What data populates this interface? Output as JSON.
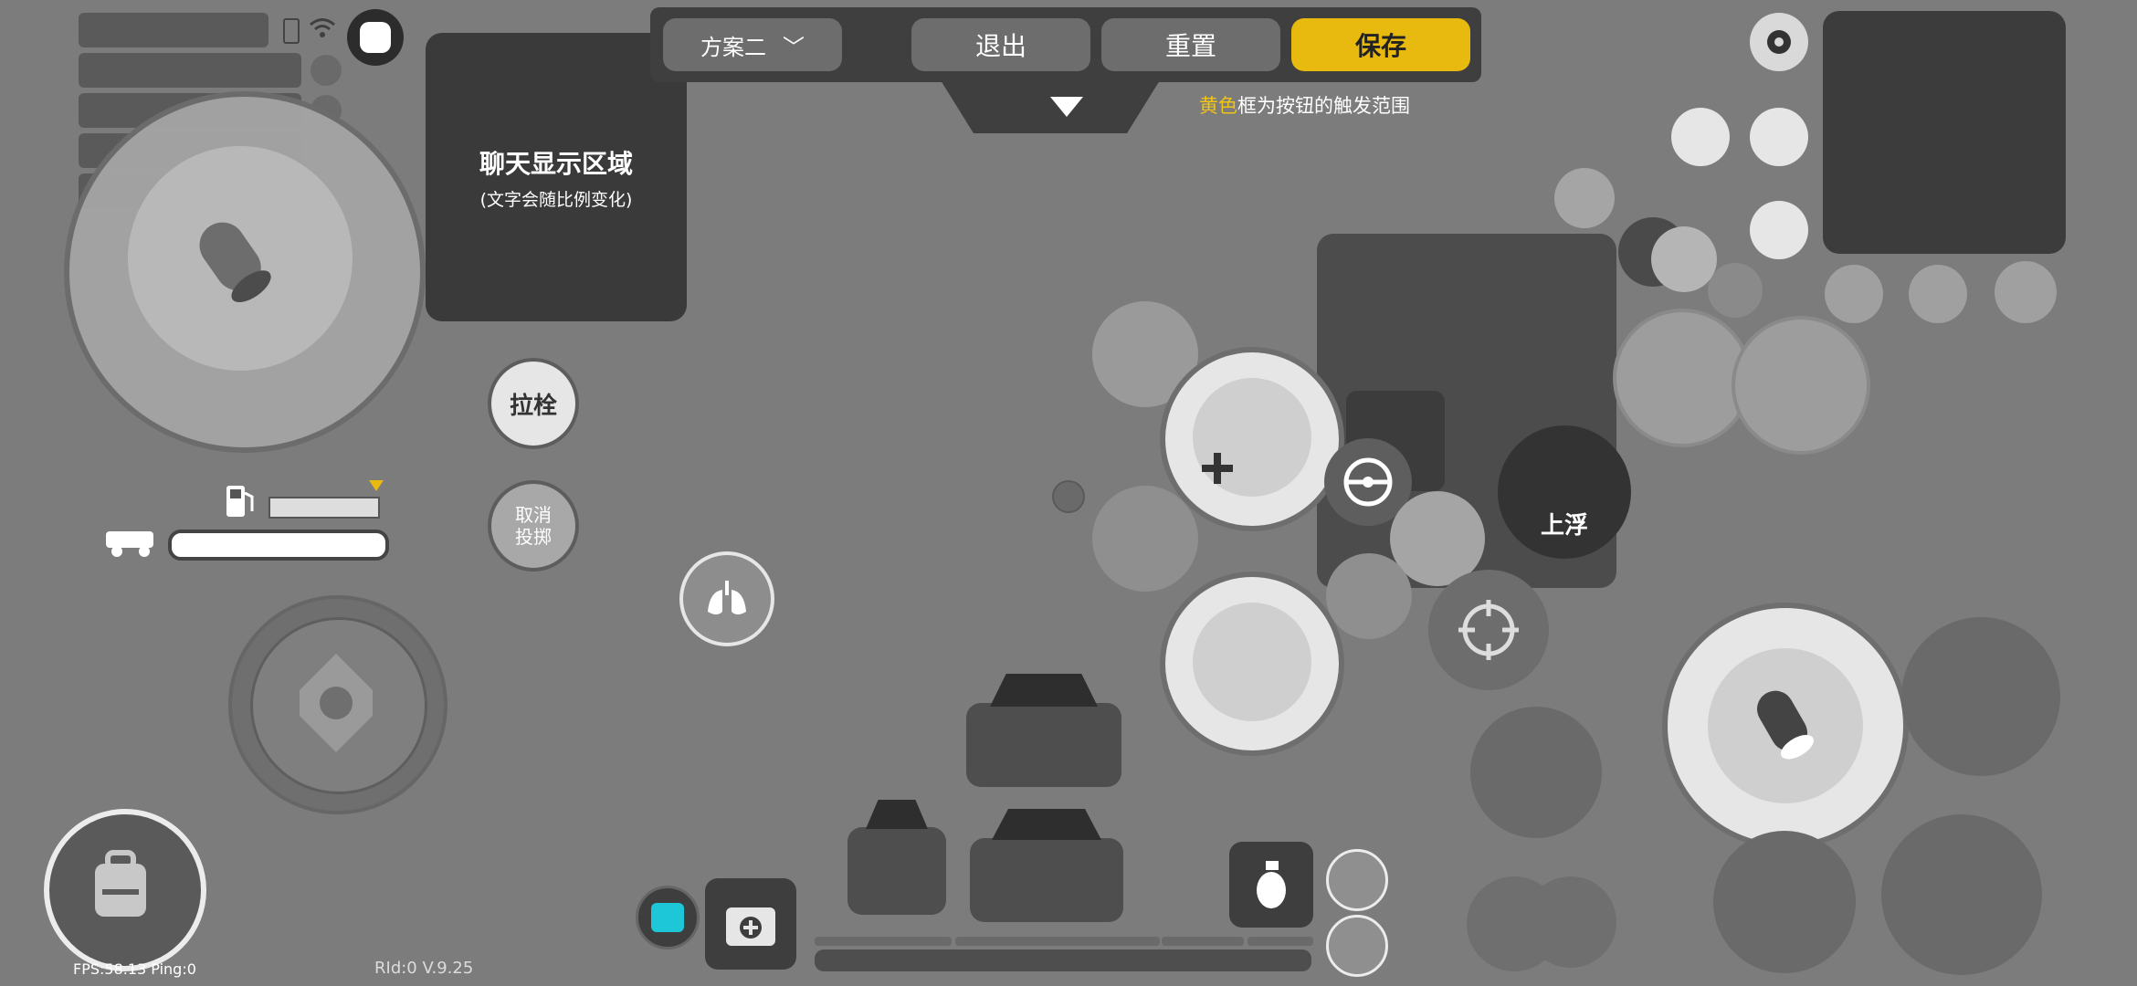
{
  "toolbar": {
    "scheme_label": "方案二",
    "exit_label": "退出",
    "reset_label": "重置",
    "save_label": "保存"
  },
  "hint": {
    "highlight": "黄色",
    "rest": "框为按钮的触发范围"
  },
  "chat": {
    "title": "聊天显示区域",
    "subtitle": "(文字会随比例变化)"
  },
  "buttons": {
    "bolt_label": "拉栓",
    "cancel_throw_label": "取消投掷",
    "float_up_label": "上浮"
  },
  "footer": {
    "fps": "FPS:58.13 Ping:0",
    "version": "RId:0 V.9.25"
  },
  "colors": {
    "accent": "#e8b90f",
    "background": "#7c7c7c",
    "panel": "#3f3f3f"
  },
  "icons": [
    "battery-icon",
    "wifi-icon",
    "emoji-face-icon",
    "settings-gear-icon",
    "exit-door-icon",
    "speaker-icon",
    "microphone-icon",
    "eye-icon",
    "chat-bubble-icon",
    "lungs-icon",
    "crosshair-icon",
    "steering-wheel-icon",
    "fuel-icon",
    "vehicle-icon",
    "backpack-icon",
    "medkit-icon",
    "grenade-icon",
    "bullet-icon",
    "shirt-icon"
  ]
}
